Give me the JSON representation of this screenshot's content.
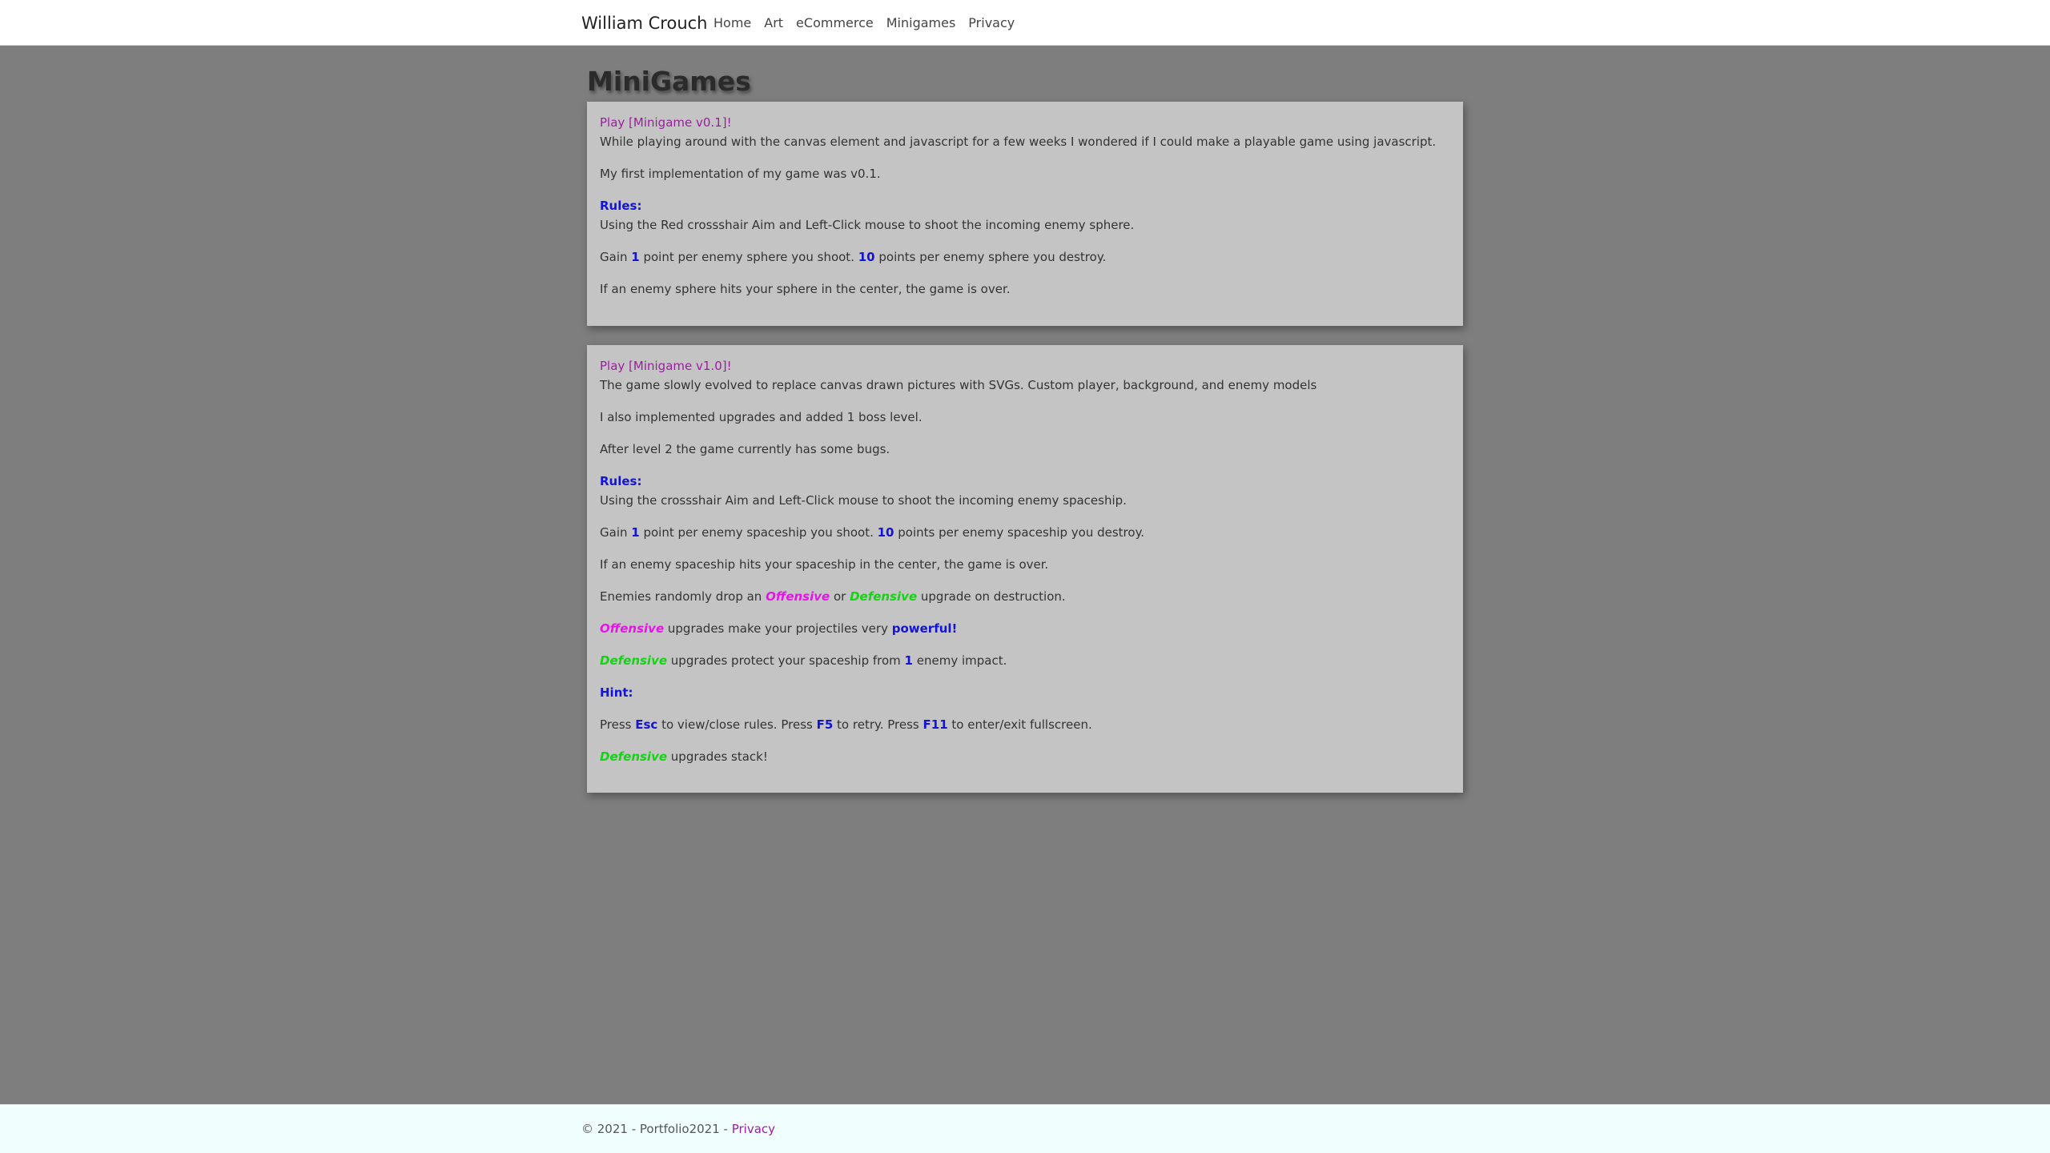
{
  "nav": {
    "brand": "William Crouch",
    "links": [
      "Home",
      "Art",
      "eCommerce",
      "Minigames",
      "Privacy"
    ]
  },
  "main": {
    "title": "MiniGames",
    "card1": {
      "play_link": "Play [Minigame v0.1]!",
      "intro": "While playing around with the canvas element and javascript for a few weeks I wondered if I could make a playable game using javascript.",
      "first_impl": "My first implementation of my game was v0.1.",
      "rules_heading": "Rules:",
      "rule_aim": "Using the Red crossshair Aim and Left-Click mouse to shoot the incoming enemy sphere.",
      "gain_a": "Gain ",
      "gain_n1": "1",
      "gain_b": " point per enemy sphere you shoot. ",
      "gain_n2": "10",
      "gain_c": " points per enemy sphere you destroy.",
      "game_over": "If an enemy sphere hits your sphere in the center, the game is over."
    },
    "card2": {
      "play_link": "Play [Minigame v1.0]!",
      "intro": "The game slowly evolved to replace canvas drawn pictures with SVGs. Custom player, background, and enemy models",
      "upgrades": "I also implemented upgrades and added 1 boss level.",
      "bugs": "After level 2 the game currently has some bugs.",
      "rules_heading": "Rules:",
      "rule_aim": "Using the crossshair Aim and Left-Click mouse to shoot the incoming enemy spaceship.",
      "gain_a": "Gain ",
      "gain_n1": "1",
      "gain_b": " point per enemy spaceship you shoot. ",
      "gain_n2": "10",
      "gain_c": " points per enemy spaceship you destroy.",
      "game_over": "If an enemy spaceship hits your spaceship in the center, the game is over.",
      "drop_a": "Enemies randomly drop an ",
      "offensive": "Offensive",
      "drop_or": " or ",
      "defensive": "Defensive",
      "drop_b": " upgrade on destruction.",
      "off_desc": " upgrades make your projectiles very ",
      "powerful": "powerful!",
      "def_desc_a": " upgrades protect your spaceship from ",
      "def_num": "1",
      "def_desc_b": " enemy impact.",
      "hint_heading": "Hint:",
      "press_a": "Press ",
      "key_esc": "Esc",
      "press_b": " to view/close rules. Press ",
      "key_f5": "F5",
      "press_c": " to retry. Press ",
      "key_f11": "F11",
      "press_d": " to enter/exit fullscreen.",
      "stack": " upgrades stack!"
    }
  },
  "footer": {
    "text": "© 2021 - Portfolio2021 - ",
    "privacy": "Privacy"
  },
  "colors": {
    "background": "#7e7e7e",
    "card": "#c4c4c4",
    "link": "#9a1ea0",
    "emphasis_blue": "#1414d6",
    "offensive": "#e614e6",
    "defensive": "#14d214"
  }
}
